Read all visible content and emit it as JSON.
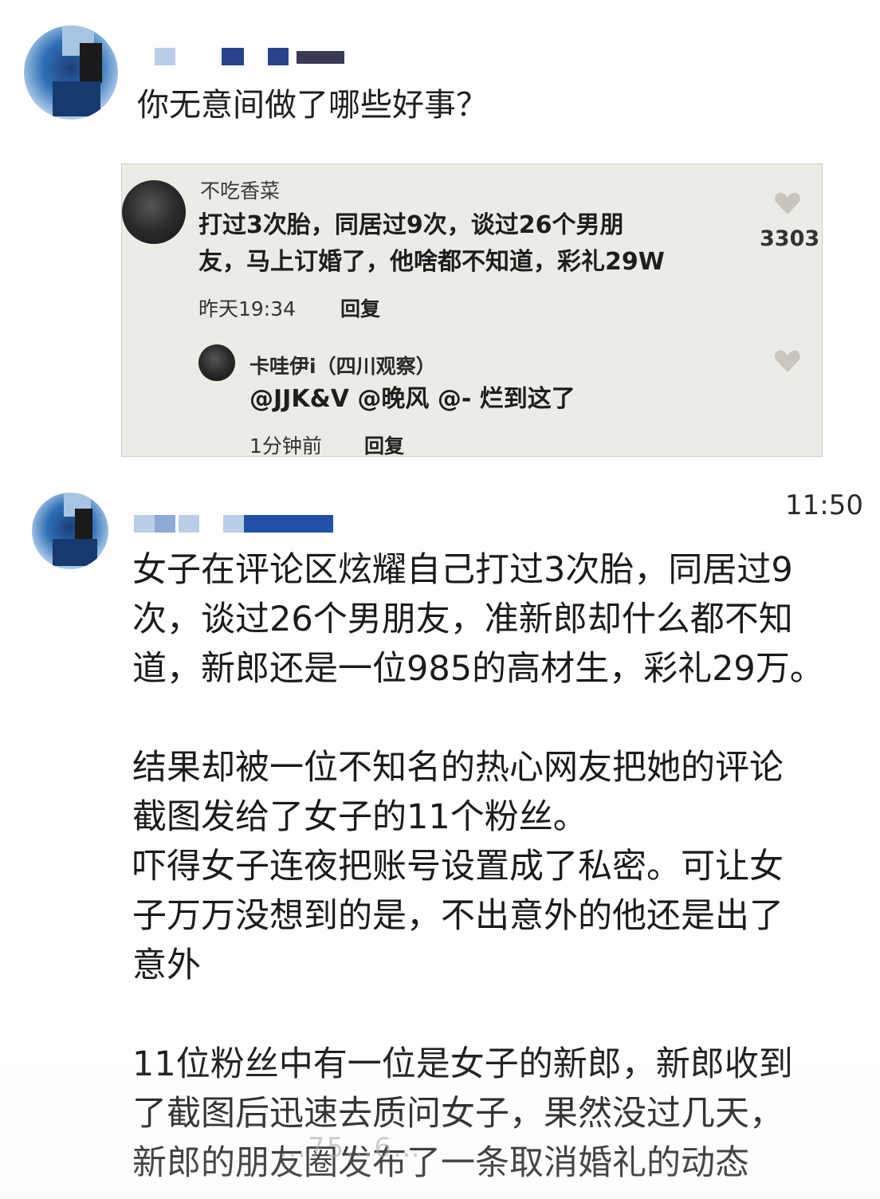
{
  "post1": {
    "question": "你无意间做了哪些好事？"
  },
  "quoted_card": {
    "comment": {
      "username": "不吃香菜",
      "text_line1": "打过3次胎，同居过9次，谈过26个男朋",
      "text_line2": "友，马上订婚了，他啥都不知道，彩礼29W",
      "time": "昨天19:34",
      "reply_label": "回复",
      "likes": "3303"
    },
    "reply": {
      "username": "卡哇伊i（四川观察）",
      "text": "@JJK&V @晚风 @- 烂到这了",
      "time": "1分钟前",
      "reply_label": "回复"
    }
  },
  "post2": {
    "time": "11:50",
    "lines": [
      "女子在评论区炫耀自己打过3次胎，同居过9",
      "次，谈过26个男朋友，准新郎却什么都不知",
      "道，新郎还是一位985的高材生，彩礼29万。",
      "",
      "结果却被一位不知名的热心网友把她的评论",
      "截图发给了女子的11个粉丝。",
      "吓得女子连夜把账号设置成了私密。可让女",
      "子万万没想到的是，不出意外的他还是出了",
      "意外",
      "",
      "11位粉丝中有一位是女子的新郎，新郎收到",
      "了截图后迅速去质问女子，果然没过几天，",
      "新郎的朋友圈发布了一条取消婚礼的动态"
    ]
  },
  "watermark": "…75…6…"
}
